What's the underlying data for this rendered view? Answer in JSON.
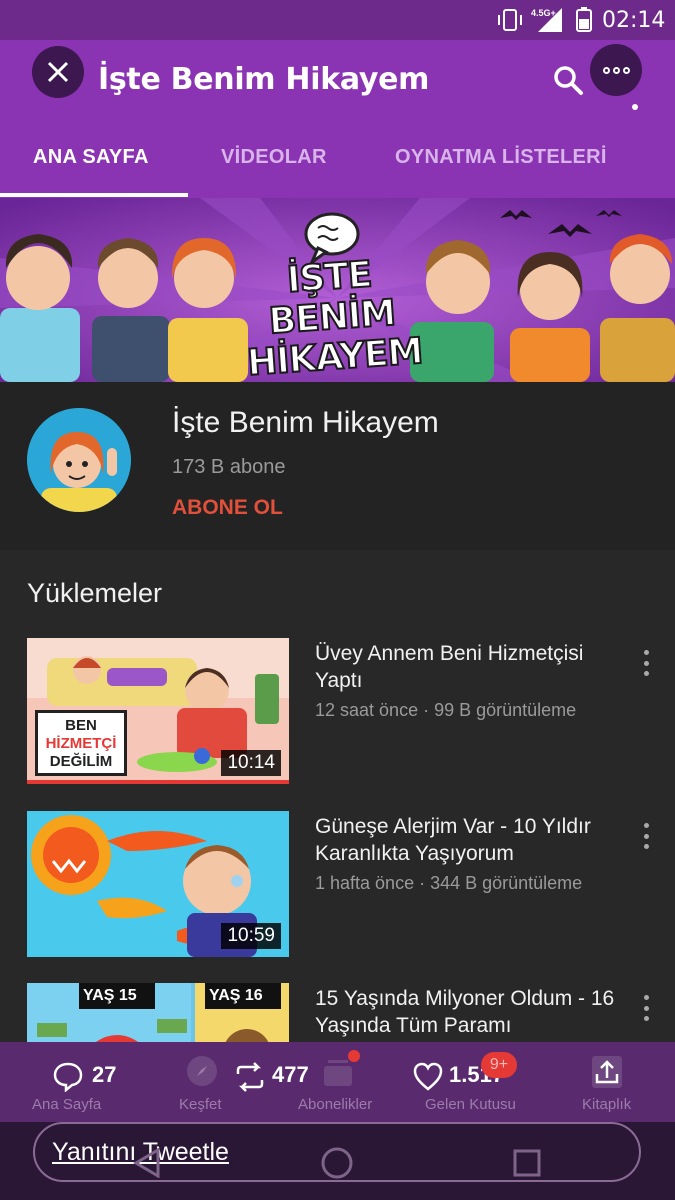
{
  "status_bar": {
    "time": "02:14",
    "network": "4.5G+"
  },
  "app_bar": {
    "title": "İşte Benim Hikayem"
  },
  "tabs": [
    {
      "label": "ANA SAYFA",
      "active": true
    },
    {
      "label": "VİDEOLAR",
      "active": false
    },
    {
      "label": "OYNATMA LİSTELERİ",
      "active": false
    }
  ],
  "banner": {
    "line1": "İŞTE BENİM",
    "line2": "HİKAYEM"
  },
  "channel": {
    "name": "İşte Benim Hikayem",
    "subscribers": "173 B abone",
    "subscribe_label": "ABONE OL"
  },
  "uploads": {
    "title": "Yüklemeler",
    "videos": [
      {
        "title": "Üvey Annem Beni Hizmetçisi Yaptı",
        "meta": "12 saat önce · 99 B görüntüleme",
        "duration": "10:14",
        "thumb_text": [
          "BEN",
          "HİZMETÇİ",
          "DEĞİLİM"
        ]
      },
      {
        "title": "Güneşe Alerjim Var - 10 Yıldır Karanlıkta Yaşıyorum",
        "meta": "1 hafta önce · 344 B görüntüleme",
        "duration": "10:59"
      },
      {
        "title": "15 Yaşında Milyoner Oldum - 16 Yaşında Tüm Paramı",
        "thumb_text": [
          "YAŞ 15",
          "YAŞ 16"
        ]
      }
    ]
  },
  "bottom_nav": {
    "items": [
      "Ana Sayfa",
      "Keşfet",
      "Abonelikler",
      "Gelen Kutusu",
      "Kitaplık"
    ],
    "inbox_badge": "9+"
  },
  "tweet_actions": {
    "replies": "27",
    "retweets": "477",
    "likes": "1.517"
  },
  "reply_bar": {
    "placeholder": "Yanıtını Tweetle"
  },
  "colors": {
    "brand_purple": "#8b34b3",
    "subscribe_red": "#e0503a",
    "background": "#282828"
  }
}
